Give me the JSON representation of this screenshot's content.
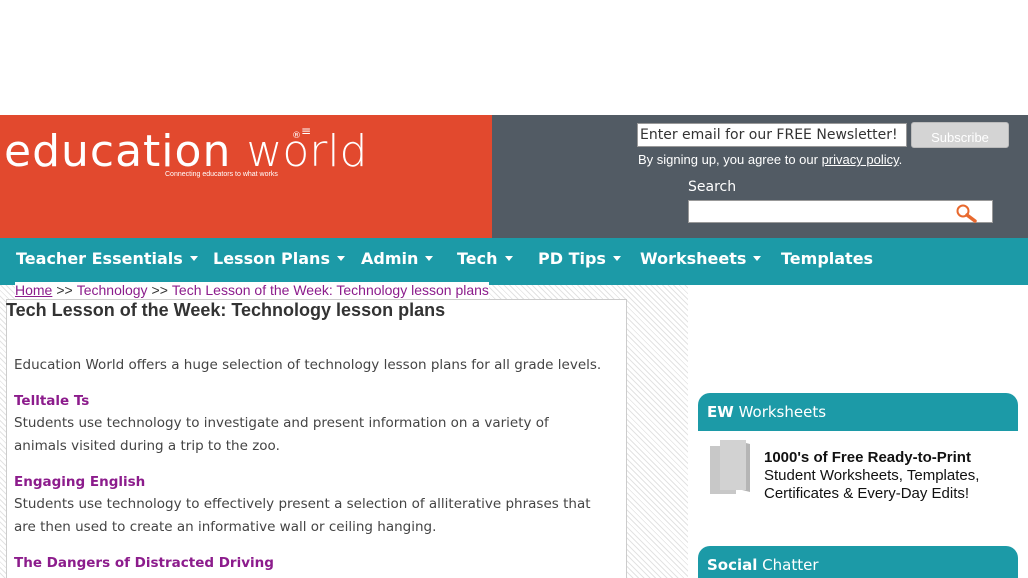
{
  "header": {
    "logo_word1": "education",
    "logo_word2": "world",
    "logo_reg": "®",
    "logo_tagline": "Connecting educators to what works",
    "menu_icon": "≡",
    "newsletter_placeholder": "Enter email for our FREE Newsletter!",
    "subscribe_label": "Subscribe",
    "signup_text": "By signing up, you agree to our",
    "privacy_link": "privacy policy",
    "signup_period": ".",
    "search_label": "Search",
    "search_value": ""
  },
  "nav": {
    "items": [
      {
        "label": "Teacher Essentials",
        "dropdown": true
      },
      {
        "label": "Lesson Plans",
        "dropdown": true
      },
      {
        "label": "Admin",
        "dropdown": true
      },
      {
        "label": "Tech",
        "dropdown": true
      },
      {
        "label": "PD Tips",
        "dropdown": true
      },
      {
        "label": "Worksheets",
        "dropdown": true
      },
      {
        "label": "Templates",
        "dropdown": false
      }
    ]
  },
  "breadcrumb": {
    "items": [
      "Home",
      "Technology",
      "Tech Lesson of the Week: Technology lesson plans"
    ],
    "separator": ">>"
  },
  "main": {
    "title": "Tech Lesson of the Week: Technology lesson plans",
    "intro": "Education World offers a huge selection of technology lesson plans for all grade levels.",
    "lessons": [
      {
        "title": "Telltale Ts",
        "desc": "Students use technology to investigate and present information on a variety of animals visited during a trip to the zoo."
      },
      {
        "title": "Engaging English",
        "desc": "Students use technology to effectively present a selection of alliterative phrases that are then used to create an informative wall or ceiling hanging."
      },
      {
        "title": "The Dangers of Distracted Driving",
        "desc": ""
      }
    ]
  },
  "sidebar": {
    "worksheets": {
      "header_bold": "EW",
      "header_rest": " Worksheets",
      "line1": "1000's of Free Ready-to-Print",
      "line2": "Student Worksheets, Templates,",
      "line3": "Certificates & Every-Day Edits!"
    },
    "social": {
      "header_bold": "Social",
      "header_rest": " Chatter"
    }
  },
  "colors": {
    "logo_bg": "#e2492e",
    "header_bg": "#525b64",
    "nav_bg": "#1c9aa7",
    "link": "#8c1c8c"
  }
}
